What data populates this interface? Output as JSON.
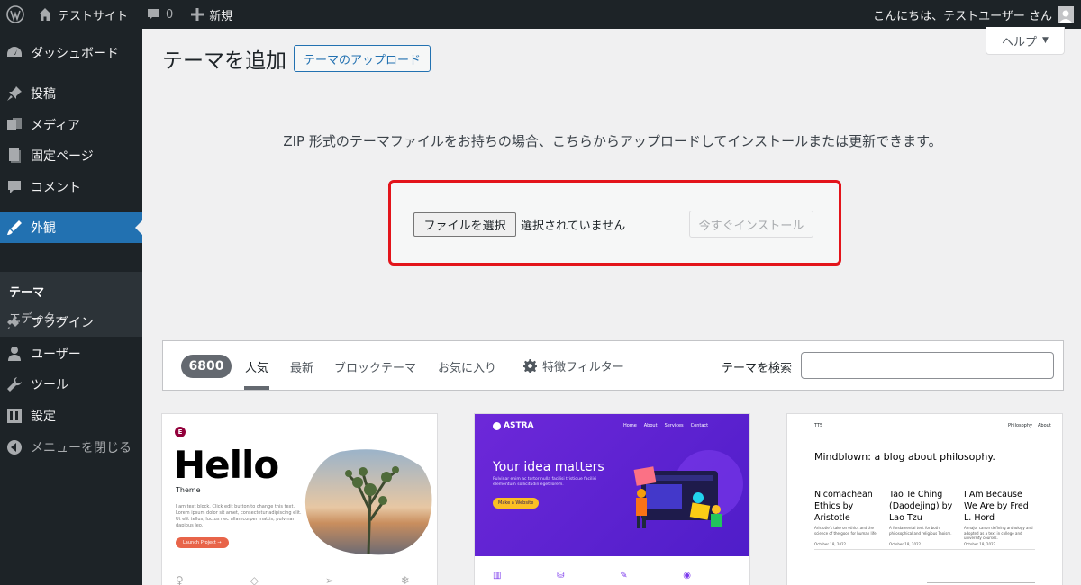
{
  "admin_bar": {
    "site_name": "テストサイト",
    "comments_count": "0",
    "new_label": "新規",
    "greeting": "こんにちは、テストユーザー さん"
  },
  "sidebar": {
    "items": [
      {
        "label": "ダッシュボード",
        "icon": "dashboard-icon"
      },
      {
        "label": "投稿",
        "icon": "pin-icon"
      },
      {
        "label": "メディア",
        "icon": "media-icon"
      },
      {
        "label": "固定ページ",
        "icon": "page-icon"
      },
      {
        "label": "コメント",
        "icon": "comment-icon"
      },
      {
        "label": "外観",
        "icon": "appearance-icon"
      },
      {
        "label": "プラグイン",
        "icon": "plugin-icon"
      },
      {
        "label": "ユーザー",
        "icon": "user-icon"
      },
      {
        "label": "ツール",
        "icon": "wrench-icon"
      },
      {
        "label": "設定",
        "icon": "settings-icon"
      },
      {
        "label": "メニューを閉じる",
        "icon": "collapse-icon"
      }
    ],
    "submenu": [
      "テーマ",
      "エディター"
    ]
  },
  "header": {
    "title": "テーマを追加",
    "upload_button": "テーマのアップロード",
    "help_label": "ヘルプ"
  },
  "upload": {
    "help_text": "ZIP 形式のテーマファイルをお持ちの場合、こちらからアップロードしてインストールまたは更新できます。",
    "file_button": "ファイルを選択",
    "file_status": "選択されていません",
    "install_button": "今すぐインストール"
  },
  "filter_bar": {
    "count": "6800",
    "tabs": [
      "人気",
      "最新",
      "ブロックテーマ",
      "お気に入り"
    ],
    "feature_filter": "特徴フィルター",
    "search_label": "テーマを検索"
  },
  "themes": {
    "hello": {
      "title": "Hello",
      "subtitle": "Theme",
      "body": "I am text block. Click edit button to change this text. Lorem ipsum dolor sit amet, consectetur adipiscing elit. Ut elit tellus, luctus nec ullamcorper mattis, pulvinar dapibus leo.",
      "button": "Launch Project →"
    },
    "astra": {
      "logo": "ASTRA",
      "nav": [
        "Home",
        "About",
        "Services",
        "Contact"
      ],
      "headline": "Your idea matters",
      "body": "Pulvinar enim ac tortor nulla facilisi tristique facilisi elementum sollicitudin eget lorem.",
      "button": "Make a Website"
    },
    "tt": {
      "logo": "TT5",
      "nav": [
        "Philosophy",
        "About"
      ],
      "headline": "Mindblown: a blog about philosophy.",
      "posts": [
        {
          "title": "Nicomachean Ethics by Aristotle",
          "text": "Aristotle's take on ethics and the science of the good for human life.",
          "date": "October 18, 2022"
        },
        {
          "title": "Tao Te Ching (Daodejing) by Lao Tzu",
          "text": "A fundamental text for both philosophical and religious Taoism.",
          "date": "October 18, 2022"
        },
        {
          "title": "I Am Because We Are by Fred L. Hord",
          "text": "A major canon defining anthology and adopted as a text in college and university courses.",
          "date": "October 18, 2022"
        }
      ]
    }
  },
  "colors": {
    "admin_dark": "#1d2327",
    "accent_blue": "#2271b1",
    "highlight_red": "#e3141b",
    "astra_purple": "#5b21d6"
  }
}
